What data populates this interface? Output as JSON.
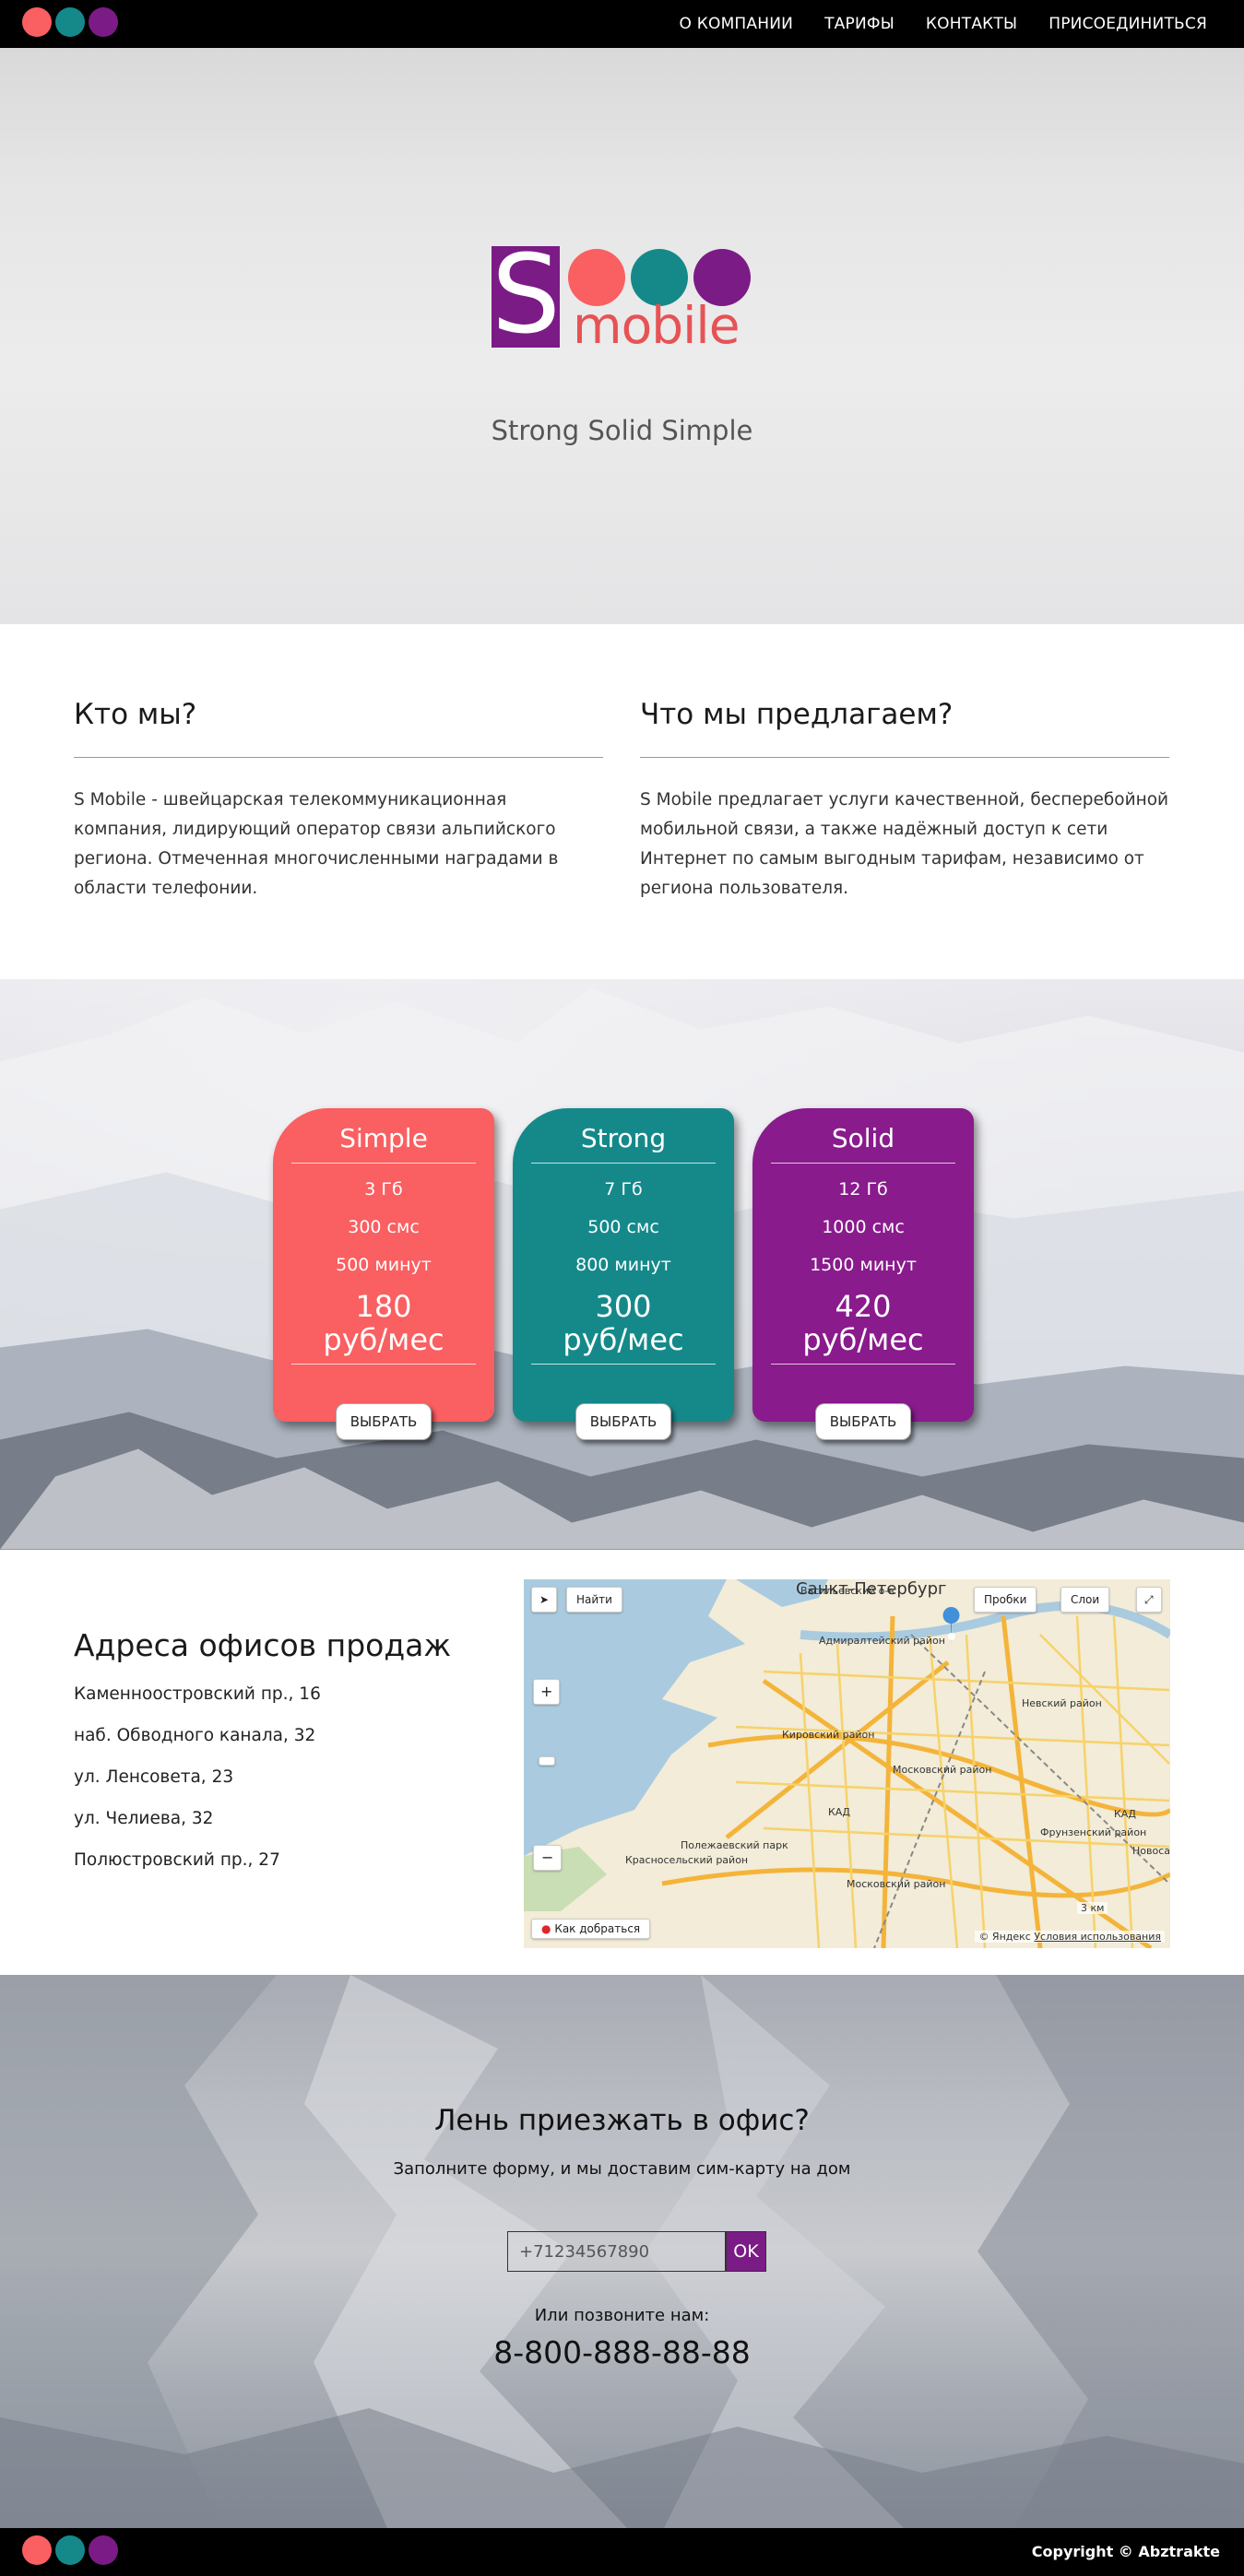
{
  "nav": {
    "links": [
      "О КОМПАНИИ",
      "ТАРИФЫ",
      "КОНТАКТЫ",
      "ПРИСОЕДИНИТЬСЯ"
    ]
  },
  "brand": {
    "letter": "S",
    "word": "mobile",
    "tagline": "Strong Solid Simple",
    "colors": {
      "coral": "#fa5f61",
      "teal": "#15898a",
      "purple": "#7b1b86"
    }
  },
  "about": {
    "who": {
      "title": "Кто мы?",
      "text": "S Mobile - швейцарская телекоммуникационная компания, лидирующий оператор связи альпийского региона. Отмеченная многочисленными наградами в области телефонии."
    },
    "offer": {
      "title": "Что мы предлагаем?",
      "text": "S Mobile предлагает услуги качественной, бесперебойной мобильной связи, а также надёжный доступ к сети Интернет по самым выгодным тарифам, независимо от региона пользователя."
    }
  },
  "tariffs": [
    {
      "name": "Simple",
      "data": "3 Гб",
      "sms": "300 смс",
      "minutes": "500 минут",
      "price": "180",
      "unit": "руб/мес",
      "button": "ВЫБРАТЬ",
      "color": "#fa5f61"
    },
    {
      "name": "Strong",
      "data": "7 Гб",
      "sms": "500 смс",
      "minutes": "800 минут",
      "price": "300",
      "unit": "руб/мес",
      "button": "ВЫБРАТЬ",
      "color": "#15898a"
    },
    {
      "name": "Solid",
      "data": "12 Гб",
      "sms": "1000 смс",
      "minutes": "1500 минут",
      "price": "420",
      "unit": "руб/мес",
      "button": "ВЫБРАТЬ",
      "color": "#891b8c"
    }
  ],
  "offices": {
    "title": "Адреса офисов продаж",
    "addresses": [
      "Каменноостровский пр., 16",
      "наб. Обводного канала, 32",
      "ул. Ленсовета, 23",
      "ул. Челиева, 32",
      "Полюстровский пр., 27"
    ]
  },
  "map": {
    "find_button": "Найти",
    "traffic_button": "Пробки",
    "layers_button": "Слои",
    "city_label": "Санкт-Петербург",
    "route_label": "Как добраться",
    "scale": "3 км",
    "copyright": "© Яндекс",
    "terms": "Условия использования",
    "district_labels": [
      "Васильевский о-в",
      "Адмиралтейский район",
      "Кировский район",
      "Московский район",
      "Фрунзенский район",
      "Невский район",
      "Полежаевский парк",
      "Красносельский район",
      "Московский район",
      "КАД",
      "КАД",
      "Новосаратовка"
    ]
  },
  "cta": {
    "title": "Лень приезжать в офис?",
    "subtitle": "Заполните форму, и мы доставим сим-карту на дом",
    "phone_placeholder": "+71234567890",
    "ok_button": "OK",
    "call_text": "Или позвоните нам:",
    "phone": "8-800-888-88-88"
  },
  "footer": {
    "copyright": "Copyright © Abztrakte"
  }
}
